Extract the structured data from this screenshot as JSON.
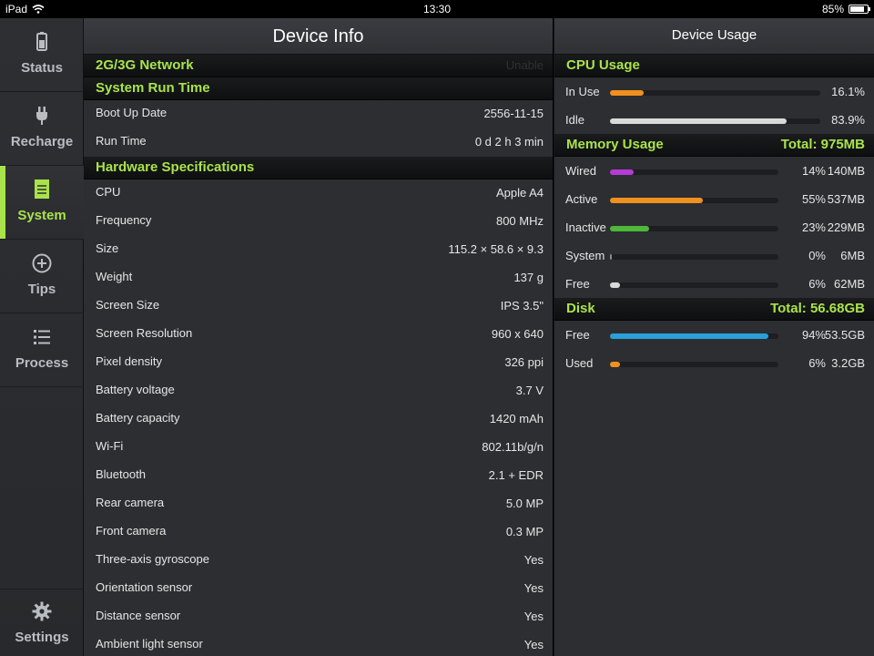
{
  "status_bar": {
    "device": "iPad",
    "time": "13:30",
    "battery": "85%",
    "battery_level": 0.85
  },
  "sidebar": {
    "items": [
      {
        "label": "Status",
        "icon": "battery-icon"
      },
      {
        "label": "Recharge",
        "icon": "plug-icon"
      },
      {
        "label": "System",
        "icon": "notepad-icon",
        "active": true
      },
      {
        "label": "Tips",
        "icon": "plus-circle-icon"
      },
      {
        "label": "Process",
        "icon": "list-icon"
      }
    ],
    "settings": {
      "label": "Settings",
      "icon": "gear-icon"
    }
  },
  "device_info": {
    "title": "Device Info",
    "network": {
      "label": "2G/3G Network",
      "value": "Unable"
    },
    "run_time": {
      "label": "System Run Time",
      "rows": [
        {
          "key": "Boot Up Date",
          "value": "2556-11-15"
        },
        {
          "key": "Run Time",
          "value": "0 d 2 h 3 min"
        }
      ]
    },
    "hardware": {
      "label": "Hardware Specifications",
      "rows": [
        {
          "key": "CPU",
          "value": "Apple A4"
        },
        {
          "key": "Frequency",
          "value": "800 MHz"
        },
        {
          "key": "Size",
          "value": "115.2 × 58.6 × 9.3"
        },
        {
          "key": "Weight",
          "value": "137 g"
        },
        {
          "key": "Screen Size",
          "value": "IPS 3.5\""
        },
        {
          "key": "Screen Resolution",
          "value": "960 x 640"
        },
        {
          "key": "Pixel density",
          "value": "326 ppi"
        },
        {
          "key": "Battery voltage",
          "value": "3.7 V"
        },
        {
          "key": "Battery capacity",
          "value": "1420 mAh"
        },
        {
          "key": "Wi-Fi",
          "value": "802.11b/g/n"
        },
        {
          "key": "Bluetooth",
          "value": "2.1 + EDR"
        },
        {
          "key": "Rear camera",
          "value": "5.0 MP"
        },
        {
          "key": "Front camera",
          "value": "0.3 MP"
        },
        {
          "key": "Three-axis gyroscope",
          "value": "Yes"
        },
        {
          "key": "Orientation sensor",
          "value": "Yes"
        },
        {
          "key": "Distance sensor",
          "value": "Yes"
        },
        {
          "key": "Ambient light sensor",
          "value": "Yes"
        }
      ]
    }
  },
  "device_usage": {
    "title": "Device Usage",
    "cpu": {
      "label": "CPU Usage",
      "rows": [
        {
          "key": "In Use",
          "pct": "16.1%",
          "level": 16.1,
          "color": "#f0901e"
        },
        {
          "key": "Idle",
          "pct": "83.9%",
          "level": 83.9,
          "color": "#d9d9d9"
        }
      ]
    },
    "memory": {
      "label": "Memory Usage",
      "total": "Total: 975MB",
      "rows": [
        {
          "key": "Wired",
          "pct": "14%",
          "size": "140MB",
          "level": 14,
          "color": "#b63ad6"
        },
        {
          "key": "Active",
          "pct": "55%",
          "size": "537MB",
          "level": 55,
          "color": "#f0901e"
        },
        {
          "key": "Inactive",
          "pct": "23%",
          "size": "229MB",
          "level": 23,
          "color": "#4fb83a"
        },
        {
          "key": "System",
          "pct": "0%",
          "size": "6MB",
          "level": 0.6,
          "color": "#8a8a8a"
        },
        {
          "key": "Free",
          "pct": "6%",
          "size": "62MB",
          "level": 6,
          "color": "#d9d9d9"
        }
      ]
    },
    "disk": {
      "label": "Disk",
      "total": "Total: 56.68GB",
      "rows": [
        {
          "key": "Free",
          "pct": "94%",
          "size": "53.5GB",
          "level": 94,
          "color": "#2a9fd8"
        },
        {
          "key": "Used",
          "pct": "6%",
          "size": "3.2GB",
          "level": 6,
          "color": "#f0901e"
        }
      ]
    }
  }
}
